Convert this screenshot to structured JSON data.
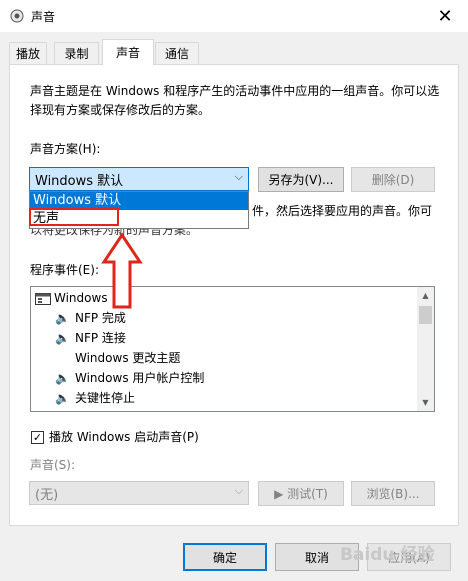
{
  "window": {
    "title": "声音",
    "close_label": "✕"
  },
  "tabs": [
    {
      "label": "播放",
      "active": false
    },
    {
      "label": "录制",
      "active": false
    },
    {
      "label": "声音",
      "active": true
    },
    {
      "label": "通信",
      "active": false
    }
  ],
  "description": "声音主题是在 Windows 和程序产生的活动事件中应用的一组声音。你可以选择现有方案或保存修改后的方案。",
  "scheme": {
    "label": "声音方案(H):",
    "selected": "Windows 默认",
    "options": [
      "Windows 默认",
      "无声"
    ],
    "save_as_label": "另存为(V)...",
    "delete_label": "删除(D)"
  },
  "hidden_desc_fragment": "件，然后选择要应用的声音。你可",
  "hidden_desc_line2": "以将更改保存为新的声音方案。",
  "events": {
    "label": "程序事件(E):",
    "items": [
      {
        "name": "Windows",
        "type": "group"
      },
      {
        "name": "NFP 完成",
        "type": "sound"
      },
      {
        "name": "NFP 连接",
        "type": "sound"
      },
      {
        "name": "Windows 更改主题",
        "type": "none"
      },
      {
        "name": "Windows 用户帐户控制",
        "type": "sound"
      },
      {
        "name": "关键性停止",
        "type": "sound"
      }
    ]
  },
  "startup_sound": {
    "label": "播放 Windows 启动声音(P)",
    "checked": true
  },
  "sound": {
    "label": "声音(S):",
    "value": "(无)",
    "test_label": "▶ 测试(T)",
    "browse_label": "浏览(B)..."
  },
  "footer": {
    "ok_label": "确定",
    "cancel_label": "取消",
    "apply_label": "应用(A)"
  },
  "watermark": "Baidu 经验",
  "colors": {
    "accent": "#0078d7",
    "highlight": "#e0261a"
  }
}
